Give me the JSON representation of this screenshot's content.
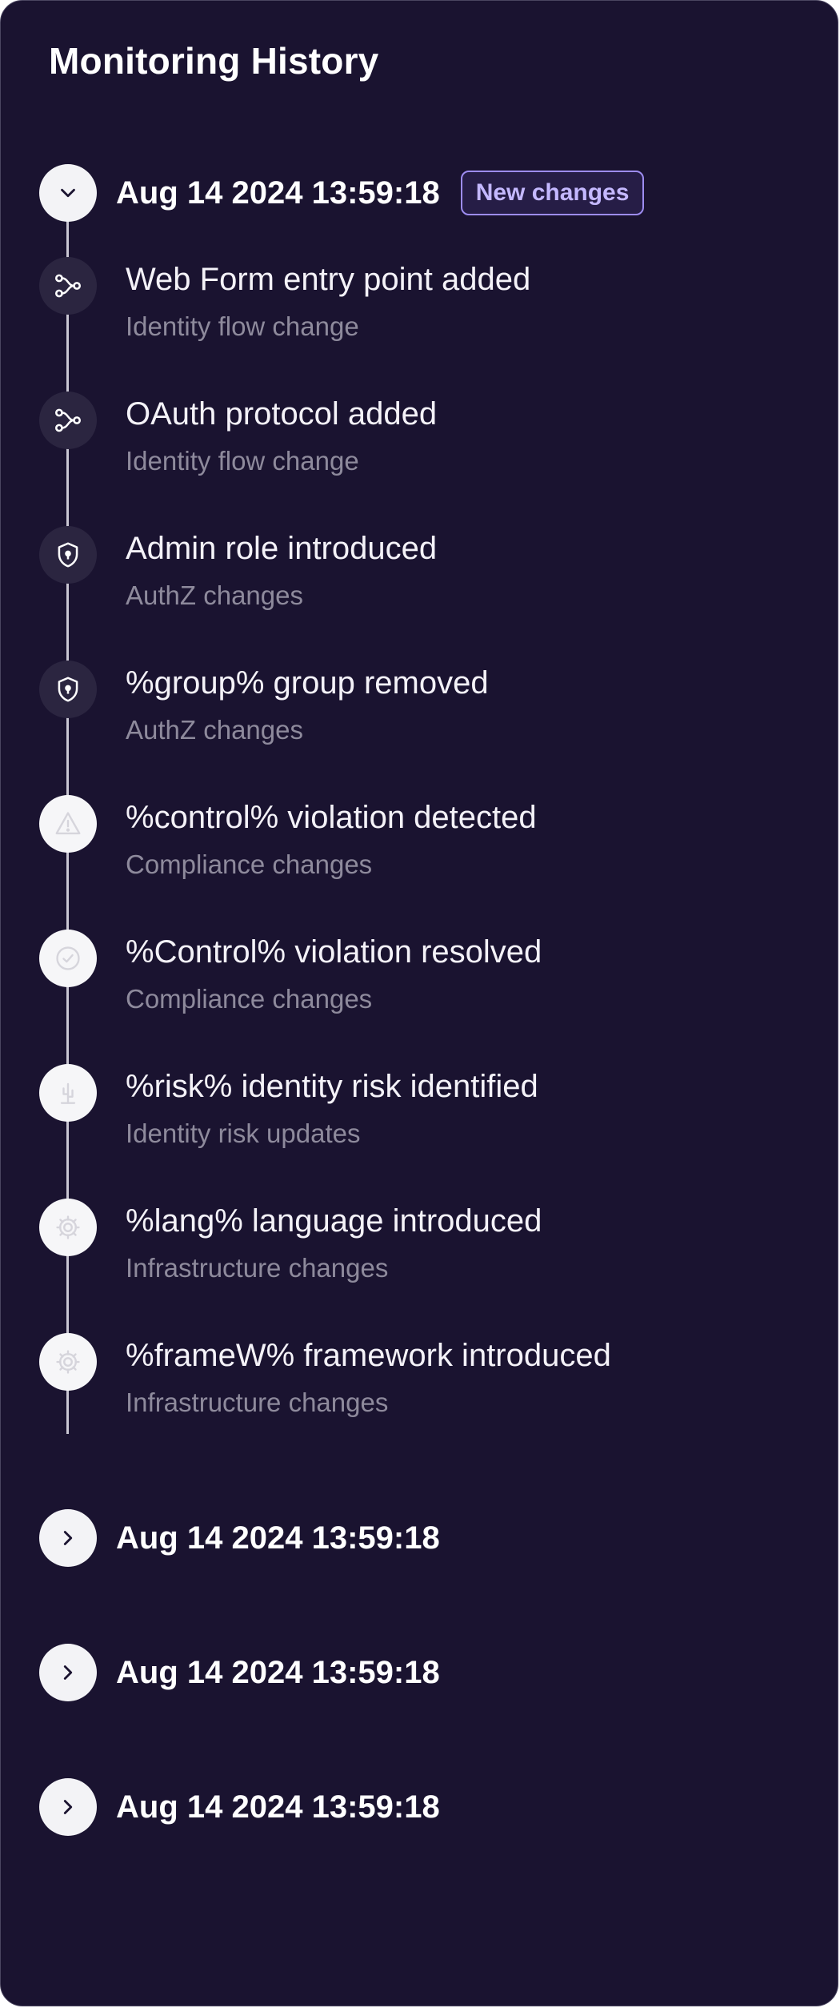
{
  "title": "Monitoring History",
  "groups": [
    {
      "date": "Aug 14 2024 13:59:18",
      "badge": "New changes",
      "expanded": true,
      "toggle_icon": "chevron-down-icon",
      "events": [
        {
          "title": "Web Form entry point added",
          "category": "Identity flow change",
          "icon": "flow-icon"
        },
        {
          "title": "OAuth protocol added",
          "category": "Identity flow change",
          "icon": "flow-icon"
        },
        {
          "title": "Admin role introduced",
          "category": "AuthZ changes",
          "icon": "shield-icon"
        },
        {
          "title": "%group% group removed",
          "category": "AuthZ changes",
          "icon": "shield-icon"
        },
        {
          "title": "%control% violation detected",
          "category": "Compliance changes",
          "icon": "warning-icon"
        },
        {
          "title": "%Control% violation resolved",
          "category": "Compliance changes",
          "icon": "check-circle-icon"
        },
        {
          "title": "%risk% identity risk identified",
          "category": "Identity risk updates",
          "icon": "cactus-icon"
        },
        {
          "title": "%lang% language introduced",
          "category": "Infrastructure changes",
          "icon": "gear-icon"
        },
        {
          "title": "%frameW% framework introduced",
          "category": "Infrastructure changes",
          "icon": "gear-icon"
        }
      ]
    },
    {
      "date": "Aug 14 2024 13:59:18",
      "expanded": false,
      "toggle_icon": "chevron-right-icon"
    },
    {
      "date": "Aug 14 2024 13:59:18",
      "expanded": false,
      "toggle_icon": "chevron-right-icon"
    },
    {
      "date": "Aug 14 2024 13:59:18",
      "expanded": false,
      "toggle_icon": "chevron-right-icon"
    }
  ],
  "colors": {
    "background": "#1a1330",
    "badge_border": "#9d8cf0",
    "badge_text": "#c4b8ff",
    "subtitle": "#8e8a9c"
  }
}
